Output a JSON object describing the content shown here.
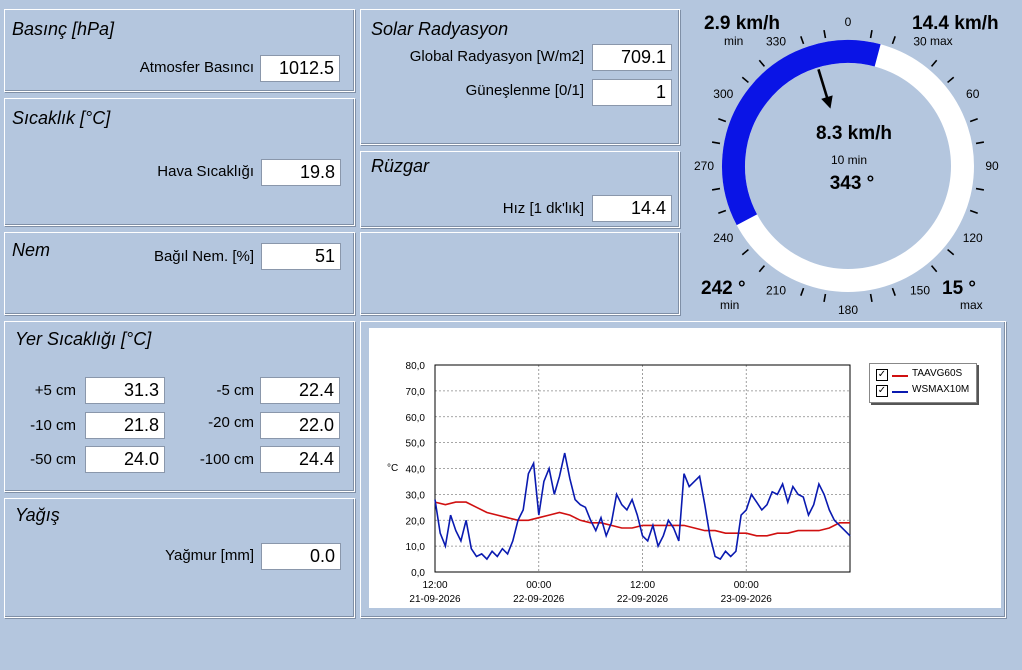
{
  "pressure": {
    "title": "Basınç [hPa]",
    "label": "Atmosfer Basıncı",
    "value": "1012.5"
  },
  "temperature": {
    "title": "Sıcaklık [°C]",
    "label": "Hava Sıcaklığı",
    "value": "19.8"
  },
  "humidity": {
    "title": "Nem",
    "label": "Bağıl Nem. [%]",
    "value": "51"
  },
  "solar": {
    "title": "Solar Radyasyon",
    "global_label": "Global Radyasyon [W/m2]",
    "global_value": "709.1",
    "sun_label": "Güneşlenme [0/1]",
    "sun_value": "1"
  },
  "wind": {
    "title": "Rüzgar",
    "speed_label": "Hız [1 dk'lık]",
    "speed_value": "14.4"
  },
  "soil": {
    "title": "Yer Sıcaklığı [°C]",
    "rows": [
      {
        "l1": "+5 cm",
        "v1": "31.3",
        "l2": "-5 cm",
        "v2": "22.4"
      },
      {
        "l1": "-10 cm",
        "v1": "21.8",
        "l2": "-20 cm",
        "v2": "22.0"
      },
      {
        "l1": "-50 cm",
        "v1": "24.0",
        "l2": "-100 cm",
        "v2": "24.4"
      }
    ]
  },
  "rain": {
    "title": "Yağış",
    "label": "Yağmur [mm]",
    "value": "0.0"
  },
  "gauge": {
    "speed_min": "2.9 km/h",
    "speed_min_label": "min",
    "speed_max": "14.4 km/h",
    "speed_max_label": "max",
    "center_speed": "8.3 km/h",
    "center_period": "10 min",
    "center_dir": "343 °",
    "dir_min": "242 °",
    "dir_min_label": "min",
    "dir_max": "15 °",
    "dir_max_label": "max",
    "arc_start_deg": 242,
    "arc_end_deg": 15,
    "arrow_deg": 343,
    "ticks": [
      "0",
      "30",
      "60",
      "90",
      "120",
      "150",
      "180",
      "210",
      "240",
      "270",
      "300",
      "330"
    ],
    "arc_color": "#0a14e6"
  },
  "chart_data": {
    "type": "line",
    "ylabel": "°C",
    "ylim": [
      0,
      80
    ],
    "yticks": [
      "80,0",
      "70,0",
      "60,0",
      "50,0",
      "40,0",
      "30,0",
      "20,0",
      "10,0",
      "0,0"
    ],
    "xticks": [
      {
        "time": "12:00",
        "date": "21-09-2026"
      },
      {
        "time": "00:00",
        "date": "22-09-2026"
      },
      {
        "time": "12:00",
        "date": "22-09-2026"
      },
      {
        "time": "00:00",
        "date": "23-09-2026"
      }
    ],
    "x_hours_range": [
      0,
      40
    ],
    "series": [
      {
        "name": "TAAVG60S",
        "color": "#d01010",
        "x": [
          0,
          1,
          2,
          3,
          4,
          5,
          6,
          7,
          8,
          9,
          10,
          11,
          12,
          13,
          14,
          15,
          16,
          17,
          18,
          19,
          20,
          21,
          22,
          23,
          24,
          25,
          26,
          27,
          28,
          29,
          30,
          31,
          32,
          33,
          34,
          35,
          36,
          37,
          38,
          39,
          40
        ],
        "y": [
          27,
          26,
          27,
          27,
          25,
          23,
          22,
          21,
          20,
          20,
          21,
          22,
          23,
          22,
          20,
          19,
          19,
          18,
          17,
          17,
          18,
          18,
          18,
          18,
          18,
          17,
          16,
          16,
          15,
          15,
          15,
          14,
          14,
          15,
          15,
          16,
          16,
          16,
          17,
          19,
          19
        ]
      },
      {
        "name": "WSMAX10M",
        "color": "#0a1ab0",
        "x": [
          0,
          0.5,
          1,
          1.5,
          2,
          2.5,
          3,
          3.5,
          4,
          4.5,
          5,
          5.5,
          6,
          6.5,
          7,
          7.5,
          8,
          8.5,
          9,
          9.5,
          10,
          10.5,
          11,
          11.5,
          12,
          12.5,
          13,
          13.5,
          14,
          14.5,
          15,
          15.5,
          16,
          16.5,
          17,
          17.5,
          18,
          18.5,
          19,
          19.5,
          20,
          20.5,
          21,
          21.5,
          22,
          22.5,
          23,
          23.5,
          24,
          24.5,
          25,
          25.5,
          26,
          26.5,
          27,
          27.5,
          28,
          28.5,
          29,
          29.5,
          30,
          30.5,
          31,
          31.5,
          32,
          32.5,
          33,
          33.5,
          34,
          34.5,
          35,
          35.5,
          36,
          36.5,
          37,
          37.5,
          38,
          38.5,
          39,
          39.5,
          40
        ],
        "y": [
          28,
          15,
          10,
          22,
          16,
          12,
          20,
          9,
          6,
          7,
          5,
          8,
          6,
          9,
          7,
          12,
          20,
          24,
          38,
          42,
          22,
          35,
          40,
          30,
          37,
          46,
          36,
          28,
          26,
          25,
          20,
          16,
          21,
          14,
          19,
          30,
          26,
          24,
          28,
          22,
          14,
          12,
          18,
          10,
          14,
          20,
          17,
          12,
          38,
          33,
          35,
          37,
          26,
          14,
          6,
          5,
          8,
          6,
          8,
          22,
          24,
          30,
          27,
          24,
          26,
          31,
          30,
          34,
          27,
          33,
          30,
          29,
          22,
          26,
          34,
          30,
          24,
          20,
          18,
          16,
          14
        ]
      }
    ]
  }
}
